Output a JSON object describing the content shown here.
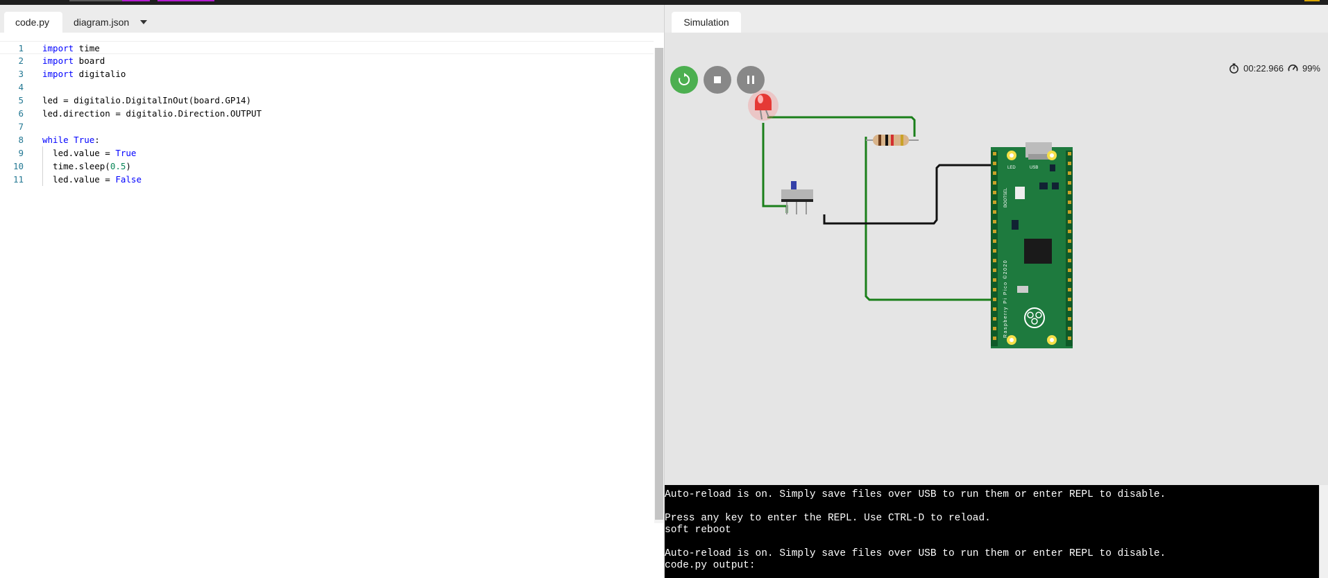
{
  "editor": {
    "tabs": [
      {
        "label": "code.py",
        "active": true
      },
      {
        "label": "diagram.json",
        "active": false
      }
    ],
    "lines": [
      {
        "num": "1",
        "tokens": [
          {
            "t": "import",
            "c": "kw"
          },
          {
            "t": " time"
          }
        ]
      },
      {
        "num": "2",
        "tokens": [
          {
            "t": "import",
            "c": "kw"
          },
          {
            "t": " board"
          }
        ]
      },
      {
        "num": "3",
        "tokens": [
          {
            "t": "import",
            "c": "kw"
          },
          {
            "t": " digitalio"
          }
        ]
      },
      {
        "num": "4",
        "tokens": [
          {
            "t": ""
          }
        ]
      },
      {
        "num": "5",
        "tokens": [
          {
            "t": "led = digitalio.DigitalInOut(board.GP14)"
          }
        ]
      },
      {
        "num": "6",
        "tokens": [
          {
            "t": "led.direction = digitalio.Direction.OUTPUT"
          }
        ]
      },
      {
        "num": "7",
        "tokens": [
          {
            "t": ""
          }
        ]
      },
      {
        "num": "8",
        "tokens": [
          {
            "t": "while",
            "c": "kw"
          },
          {
            "t": " "
          },
          {
            "t": "True",
            "c": "kw"
          },
          {
            "t": ":"
          }
        ]
      },
      {
        "num": "9",
        "tokens": [
          {
            "t": "  led.value = "
          },
          {
            "t": "True",
            "c": "kw"
          }
        ]
      },
      {
        "num": "10",
        "tokens": [
          {
            "t": "  time.sleep("
          },
          {
            "t": "0.5",
            "c": "num-lit"
          },
          {
            "t": ")"
          }
        ]
      },
      {
        "num": "11",
        "tokens": [
          {
            "t": "  led.value = "
          },
          {
            "t": "False",
            "c": "kw"
          }
        ]
      }
    ]
  },
  "simulation": {
    "tab_label": "Simulation",
    "controls": {
      "restart_icon": "restart-icon",
      "stop_icon": "stop-icon",
      "pause_icon": "pause-icon"
    },
    "elapsed_time": "00:22.966",
    "speed": "99%",
    "board": {
      "name": "Raspberry Pi Pico ©2020",
      "led_label": "LED",
      "usb_label": "USB",
      "bootsel_label": "BOOTSEL"
    },
    "colors": {
      "restart": "#4caf50",
      "wire_green": "#1a7f1a",
      "wire_black": "#111111",
      "pcb": "#1e7a3e",
      "led": "#e53935"
    }
  },
  "serial_monitor": {
    "lines": [
      "Auto-reload is on. Simply save files over USB to run them or enter REPL to disable.",
      "",
      "Press any key to enter the REPL. Use CTRL-D to reload.",
      "soft reboot",
      "",
      "Auto-reload is on. Simply save files over USB to run them or enter REPL to disable.",
      "code.py output:"
    ]
  }
}
